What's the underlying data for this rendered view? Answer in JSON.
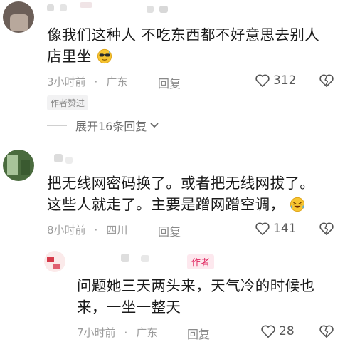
{
  "comments": [
    {
      "text_line1": "像我们这种人  不吃东西都不好意思去别人",
      "text_line2": "店里坐",
      "emoji": "smiling-face-with-sunglasses-sweat",
      "time": "3小时前",
      "location": "广东",
      "reply_label": "回复",
      "likes": "312",
      "author_tag": "作者赞过",
      "expand_label": "展开16条回复"
    },
    {
      "text_line1": "把无线网密码换了。或者把无线网拔了。",
      "text_line2": "这些人就走了。主要是蹭网蹭空调，",
      "emoji": "laughing-tears-face",
      "time": "8小时前",
      "location": "四川",
      "reply_label": "回复",
      "likes": "141"
    }
  ],
  "reply": {
    "author_badge": "作者",
    "text_line1": "问题她三天两头来，天气冷的时候也",
    "text_line2": "来，一坐一整天",
    "time": "7小时前",
    "location": "广东",
    "reply_label": "回复",
    "likes": "28"
  },
  "colors": {
    "author_badge": "#e0245e",
    "meta": "#9a9a9a"
  }
}
